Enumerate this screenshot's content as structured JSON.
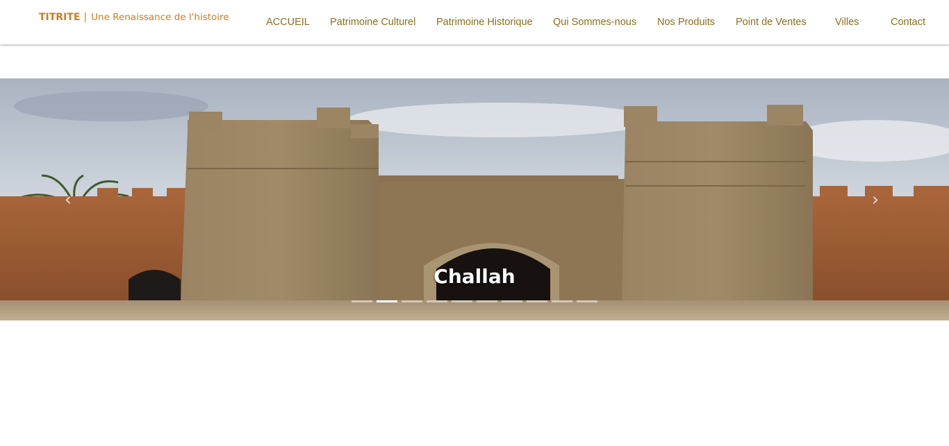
{
  "brand": {
    "name": "TITRITE",
    "separator": "|",
    "tagline": "Une Renaissance de l'histoire"
  },
  "nav": {
    "items": [
      {
        "label": "ACCUEIL"
      },
      {
        "label": "Patrimoine Culturel"
      },
      {
        "label": "Patrimoine Historique"
      },
      {
        "label": "Qui Sommes-nous"
      },
      {
        "label": "Nos Produits"
      },
      {
        "label": "Point de Ventes"
      },
      {
        "label": "Villes"
      },
      {
        "label": "Contact"
      }
    ]
  },
  "carousel": {
    "caption": "Challah",
    "prev_icon": "‹",
    "next_icon": "›",
    "indicator_count": 10,
    "active_index": 1
  },
  "colors": {
    "brand": "#d07a1e",
    "nav_link": "#8a6d1f"
  }
}
